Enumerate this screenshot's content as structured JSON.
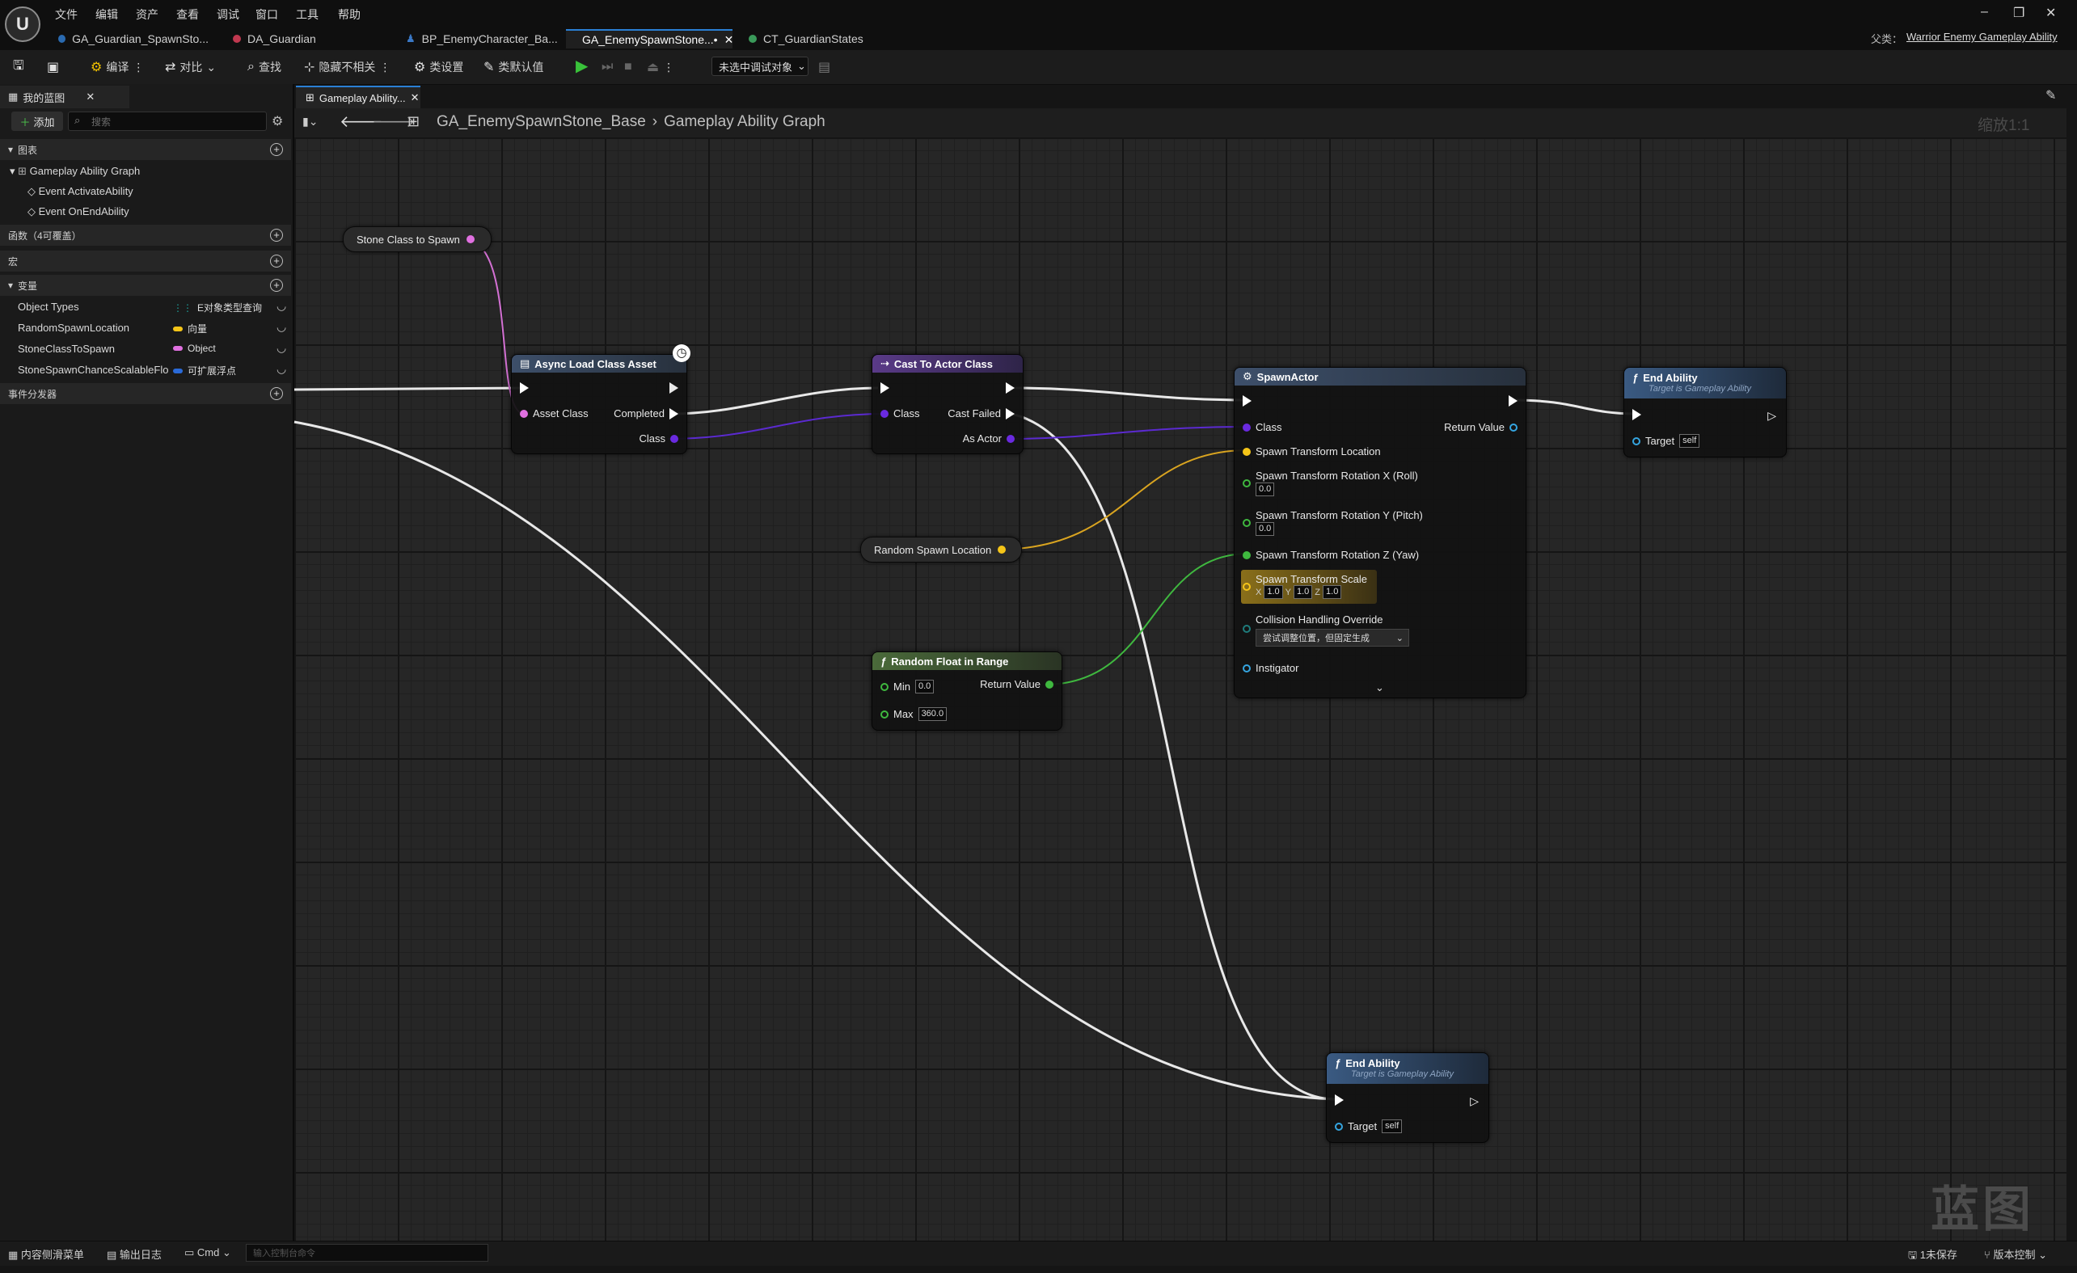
{
  "menu": [
    "文件",
    "编辑",
    "资产",
    "查看",
    "调试",
    "窗口",
    "工具",
    "帮助"
  ],
  "tabs": [
    {
      "label": "GA_Guardian_SpawnSto...",
      "color": "#2a6ab0"
    },
    {
      "label": "DA_Guardian",
      "color": "#c0384f"
    },
    {
      "label": "BP_EnemyCharacter_Ba...",
      "color": "#3a78c6"
    },
    {
      "label": "GA_EnemySpawnStone...•",
      "color": "#2a6ab0"
    },
    {
      "label": "CT_GuardianStates",
      "color": "#3a9a5a"
    }
  ],
  "parent": {
    "label": "父类：",
    "value": "Warrior Enemy Gameplay Ability"
  },
  "toolbar": {
    "compile": "编译",
    "diff": "对比",
    "find": "查找",
    "hide": "隐藏不相关",
    "class_settings": "类设置",
    "class_defaults": "类默认值",
    "debug_target": "未选中调试对象"
  },
  "left_panel": {
    "tab": "我的蓝图",
    "add": "添加",
    "search_placeholder": "搜索",
    "sec_graphs": "图表",
    "graph_name": "Gameplay Ability Graph",
    "events": [
      "Event ActivateAbility",
      "Event OnEndAbility"
    ],
    "sec_functions": "函数（4可覆盖）",
    "sec_macros": "宏",
    "sec_variables": "变量",
    "sec_dispatchers": "事件分发器",
    "variables": [
      {
        "name": "Object Types",
        "type": "E对象类型查询",
        "color": "#1ea6a0"
      },
      {
        "name": "RandomSpawnLocation",
        "type": "向量",
        "color": "#f5c518"
      },
      {
        "name": "StoneClassToSpawn",
        "type": "Object",
        "color": "#e070e0"
      },
      {
        "name": "StoneSpawnChanceScalableFloat",
        "type": "可扩展浮点",
        "color": "#2a6ad8"
      }
    ]
  },
  "graph": {
    "tab": "Gameplay Ability...",
    "asset": "GA_EnemySpawnStone_Base",
    "graph_name": "Gameplay Ability Graph",
    "zoom": "缩放1:1",
    "watermark": "蓝图"
  },
  "nodes": {
    "stone_class": {
      "label": "Stone Class to Spawn"
    },
    "async_load": {
      "title": "Async Load Class Asset",
      "in": "Asset Class",
      "completed": "Completed",
      "class": "Class"
    },
    "cast": {
      "title": "Cast To Actor Class",
      "in": "Class",
      "failed": "Cast Failed",
      "as_actor": "As Actor"
    },
    "random_loc": {
      "label": "Random Spawn Location"
    },
    "random_float": {
      "title": "Random Float in Range",
      "min_label": "Min",
      "min": "0.0",
      "max_label": "Max",
      "max": "360.0",
      "ret": "Return Value"
    },
    "spawn": {
      "title": "SpawnActor",
      "class": "Class",
      "ret": "Return Value",
      "loc": "Spawn Transform Location",
      "rotx": "Spawn Transform Rotation X (Roll)",
      "roty": "Spawn Transform Rotation Y (Pitch)",
      "rotz": "Spawn Transform Rotation Z (Yaw)",
      "rot_default": "0.0",
      "scale": "Spawn Transform Scale",
      "sx": "1.0",
      "sy": "1.0",
      "sz": "1.0",
      "collision": "Collision Handling Override",
      "collision_value": "尝试调整位置，但固定生成",
      "instigator": "Instigator"
    },
    "end1": {
      "title": "End Ability",
      "sub": "Target is Gameplay Ability",
      "target": "Target",
      "self": "self"
    },
    "end2": {
      "title": "End Ability",
      "sub": "Target is Gameplay Ability",
      "target": "Target",
      "self": "self"
    }
  },
  "status": {
    "drawer": "内容侧滑菜单",
    "log": "输出日志",
    "cmd": "Cmd",
    "cmd_placeholder": "输入控制台命令",
    "unsaved": "1未保存",
    "source": "版本控制"
  }
}
